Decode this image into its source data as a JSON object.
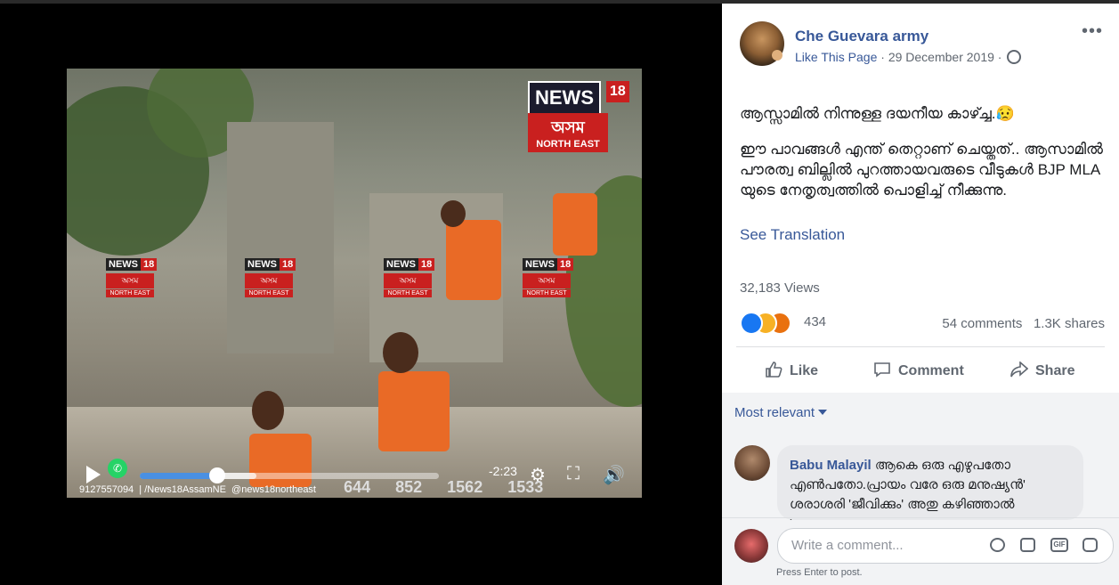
{
  "post": {
    "page_name": "Che Guevara army",
    "like_link": "Like This Page",
    "date": "29 December 2019",
    "separator": "·",
    "more": "•••",
    "line1": "ആസ്സാമിൽ നിന്നുള്ള ദയനീയ കാഴ്ച്ച.😥",
    "line2": "ഈ പാവങ്ങൾ എന്ത് തെറ്റാണ് ചെയ്തത്.. ആസാമിൽ പൗരത്വ ബില്ലിൽ പുറത്തായവരുടെ വീടുകൾ BJP MLA യുടെ നേതൃത്വത്തിൽ പൊളിച്ച് നീക്കുന്നു.",
    "see_translation": "See Translation",
    "views": "32,183 Views",
    "reaction_count": "434",
    "comments_count": "54 comments",
    "shares_count": "1.3K shares"
  },
  "actions": {
    "like": "Like",
    "comment": "Comment",
    "share": "Share"
  },
  "comments": {
    "sort": "Most relevant",
    "first": {
      "author": "Babu Malayil",
      "text": "ആകെ ഒരു എഴുപതോ എൺപതോ.പ്രായം വരേ ഒരു മനുഷ്യൻ' ശരാശരി 'ജീവിക്കും' അതു കഴിഞ്ഞാൽ 'ഓരോരുത്തരും വരും"
    },
    "input_placeholder": "Write a comment...",
    "hint": "Press Enter to post."
  },
  "video": {
    "logo_main": "NEWS",
    "logo_num": "18",
    "logo_state": "অসম",
    "logo_region": "NORTH EAST",
    "watermark_news": "NEWS",
    "watermark_num": "18",
    "watermark_state": "অসম",
    "watermark_region": "NORTH EAST",
    "time": "-2:23",
    "ticker_phone": "9127557094",
    "ticker_fb": "/News18AssamNE",
    "ticker_tw": "@news18northeast",
    "ticker_nums": [
      "644",
      "852",
      "1562",
      "1533"
    ],
    "progress_fraction": 0.26,
    "buffer_fraction": 0.39
  },
  "colors": {
    "link": "#385898",
    "brand_red": "#c9201f",
    "progress": "#4a90e2",
    "vest": "#e96a26"
  }
}
